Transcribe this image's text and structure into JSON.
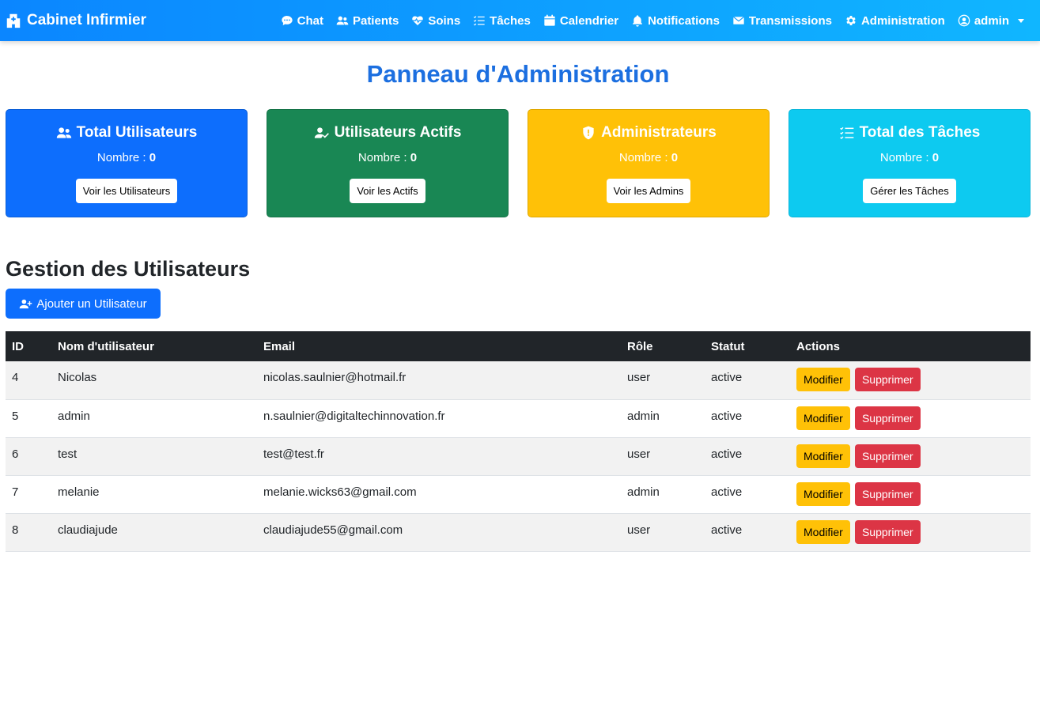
{
  "navbar": {
    "brand": "Cabinet Infirmier",
    "items": [
      {
        "label": "Chat",
        "icon": "chat-icon"
      },
      {
        "label": "Patients",
        "icon": "users-icon"
      },
      {
        "label": "Soins",
        "icon": "heart-pulse-icon"
      },
      {
        "label": "Tâches",
        "icon": "list-check-icon"
      },
      {
        "label": "Calendrier",
        "icon": "calendar-icon"
      },
      {
        "label": "Notifications",
        "icon": "bell-icon"
      },
      {
        "label": "Transmissions",
        "icon": "envelope-icon"
      },
      {
        "label": "Administration",
        "icon": "gear-icon"
      }
    ],
    "user": {
      "label": "admin",
      "icon": "user-circle-icon"
    }
  },
  "page": {
    "title": "Panneau d'Administration"
  },
  "cards": [
    {
      "title": "Total Utilisateurs",
      "count_label": "Nombre :",
      "count": "0",
      "button": "Voir les Utilisateurs",
      "color": "#0d6efd",
      "icon": "users-icon"
    },
    {
      "title": "Utilisateurs Actifs",
      "count_label": "Nombre :",
      "count": "0",
      "button": "Voir les Actifs",
      "color": "#198754",
      "icon": "user-check-icon"
    },
    {
      "title": "Administrateurs",
      "count_label": "Nombre :",
      "count": "0",
      "button": "Voir les Admins",
      "color": "#ffc107",
      "icon": "shield-icon"
    },
    {
      "title": "Total des Tâches",
      "count_label": "Nombre :",
      "count": "0",
      "button": "Gérer les Tâches",
      "color": "#0dcaf0",
      "icon": "list-check-icon"
    }
  ],
  "users_section": {
    "title": "Gestion des Utilisateurs",
    "add_button": "Ajouter un Utilisateur",
    "columns": [
      "ID",
      "Nom d'utilisateur",
      "Email",
      "Rôle",
      "Statut",
      "Actions"
    ],
    "edit_label": "Modifier",
    "delete_label": "Supprimer",
    "rows": [
      {
        "id": "4",
        "username": "Nicolas",
        "email": "nicolas.saulnier@hotmail.fr",
        "role": "user",
        "status": "active"
      },
      {
        "id": "5",
        "username": "admin",
        "email": "n.saulnier@digitaltechinnovation.fr",
        "role": "admin",
        "status": "active"
      },
      {
        "id": "6",
        "username": "test",
        "email": "test@test.fr",
        "role": "user",
        "status": "active"
      },
      {
        "id": "7",
        "username": "melanie",
        "email": "melanie.wicks63@gmail.com",
        "role": "admin",
        "status": "active"
      },
      {
        "id": "8",
        "username": "claudiajude",
        "email": "claudiajude55@gmail.com",
        "role": "user",
        "status": "active"
      }
    ]
  }
}
